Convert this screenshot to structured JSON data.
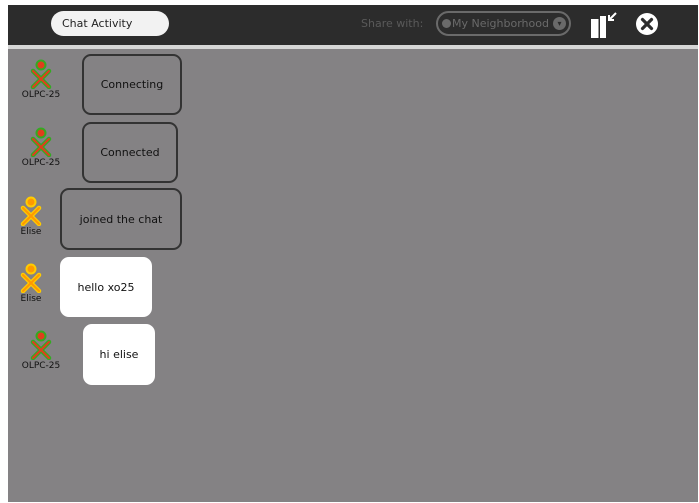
{
  "activity": {
    "title": "Chat Activity",
    "share_label": "Share with:",
    "share_value": "My Neighborhood",
    "keep_icon": "keep-journal-icon",
    "stop_icon": "stop-close-icon"
  },
  "colors": {
    "toolbar": "#2c2c2c",
    "canvas": "#848284",
    "olpc_stroke": "#33aa22",
    "olpc_fill": "#e03e1c",
    "elise_stroke": "#ffcc00",
    "elise_fill": "#ff9900"
  },
  "messages": [
    {
      "buddy": "OLPC-25",
      "text": "Connecting",
      "kind": "status"
    },
    {
      "buddy": "OLPC-25",
      "text": "Connected",
      "kind": "status"
    },
    {
      "buddy": "Elise",
      "text": "joined the chat",
      "kind": "status"
    },
    {
      "buddy": "Elise",
      "text": "hello xo25",
      "kind": "message"
    },
    {
      "buddy": "OLPC-25",
      "text": "hi elise",
      "kind": "message"
    }
  ]
}
